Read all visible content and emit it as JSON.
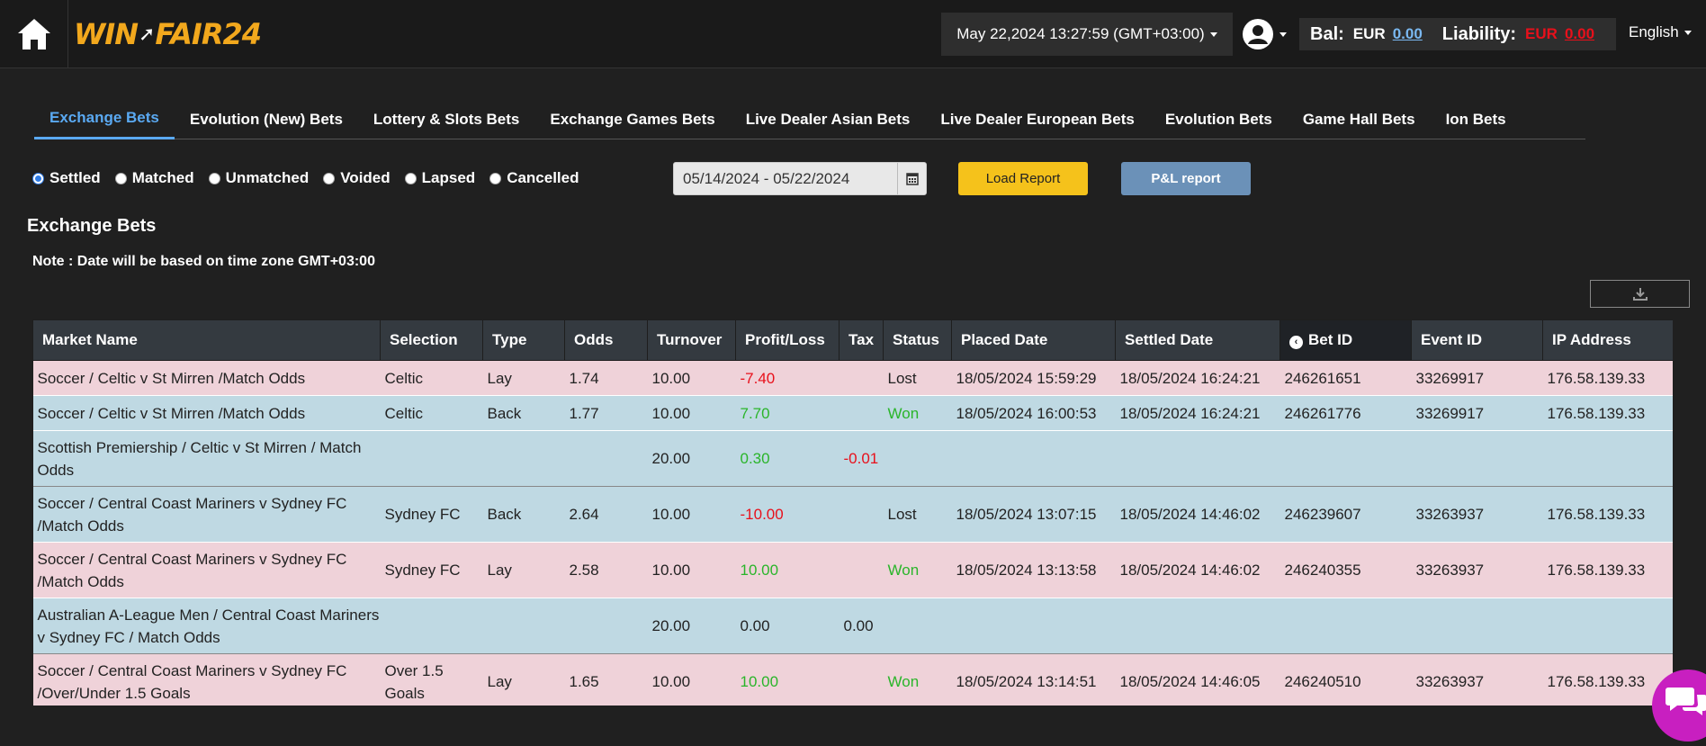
{
  "header": {
    "logo_text": "WIN",
    "logo_text2": "FAIR24",
    "datetime": "May 22,2024 13:27:59 (GMT+03:00)",
    "bal_label": "Bal:",
    "bal_currency": "EUR",
    "bal_value": "0.00",
    "liability_label": "Liability:",
    "liability_currency": "EUR",
    "liability_value": "0.00",
    "language": "English"
  },
  "tabs": [
    "Exchange Bets",
    "Evolution (New) Bets",
    "Lottery & Slots Bets",
    "Exchange Games Bets",
    "Live Dealer Asian Bets",
    "Live Dealer European Bets",
    "Evolution Bets",
    "Game Hall Bets",
    "Ion Bets"
  ],
  "filters": {
    "options": [
      "Settled",
      "Matched",
      "Unmatched",
      "Voided",
      "Lapsed",
      "Cancelled"
    ],
    "selected": "Settled",
    "date_range": "05/14/2024 - 05/22/2024",
    "load_report": "Load Report",
    "pl_report": "P&L report"
  },
  "section_title": "Exchange Bets",
  "note": "Note : Date will be based on time zone GMT+03:00",
  "table": {
    "headers": [
      "Market Name",
      "Selection",
      "Type",
      "Odds",
      "Turnover",
      "Profit/Loss",
      "Tax",
      "Status",
      "Placed Date",
      "Settled Date",
      "Bet ID",
      "Event ID",
      "IP Address"
    ],
    "rows": [
      {
        "kind": "lay",
        "market": "Soccer / Celtic v St Mirren /Match Odds",
        "selection": "Celtic",
        "type": "Lay",
        "odds": "1.74",
        "turnover": "10.00",
        "pl": "-7.40",
        "pl_sign": "neg",
        "tax": "",
        "tax_sign": "",
        "status": "Lost",
        "status_sign": "",
        "placed": "18/05/2024 15:59:29",
        "settled": "18/05/2024 16:24:21",
        "bet_id": "246261651",
        "event_id": "33269917",
        "ip": "176.58.139.33"
      },
      {
        "kind": "back",
        "market": "Soccer / Celtic v St Mirren /Match Odds",
        "selection": "Celtic",
        "type": "Back",
        "odds": "1.77",
        "turnover": "10.00",
        "pl": "7.70",
        "pl_sign": "pos",
        "tax": "",
        "tax_sign": "",
        "status": "Won",
        "status_sign": "pos",
        "placed": "18/05/2024 16:00:53",
        "settled": "18/05/2024 16:24:21",
        "bet_id": "246261776",
        "event_id": "33269917",
        "ip": "176.58.139.33"
      },
      {
        "kind": "total",
        "market": "Scottish Premiership / Celtic v St Mirren / Match Odds",
        "selection": "",
        "type": "",
        "odds": "",
        "turnover": "20.00",
        "pl": "0.30",
        "pl_sign": "pos",
        "tax": "-0.01",
        "tax_sign": "neg",
        "status": "",
        "status_sign": "",
        "placed": "",
        "settled": "",
        "bet_id": "",
        "event_id": "",
        "ip": ""
      },
      {
        "kind": "back",
        "market": "Soccer / Central Coast Mariners v Sydney FC /Match Odds",
        "selection": "Sydney FC",
        "type": "Back",
        "odds": "2.64",
        "turnover": "10.00",
        "pl": "-10.00",
        "pl_sign": "neg",
        "tax": "",
        "tax_sign": "",
        "status": "Lost",
        "status_sign": "",
        "placed": "18/05/2024 13:07:15",
        "settled": "18/05/2024 14:46:02",
        "bet_id": "246239607",
        "event_id": "33263937",
        "ip": "176.58.139.33"
      },
      {
        "kind": "lay",
        "market": "Soccer / Central Coast Mariners v Sydney FC /Match Odds",
        "selection": "Sydney FC",
        "type": "Lay",
        "odds": "2.58",
        "turnover": "10.00",
        "pl": "10.00",
        "pl_sign": "pos",
        "tax": "",
        "tax_sign": "",
        "status": "Won",
        "status_sign": "pos",
        "placed": "18/05/2024 13:13:58",
        "settled": "18/05/2024 14:46:02",
        "bet_id": "246240355",
        "event_id": "33263937",
        "ip": "176.58.139.33"
      },
      {
        "kind": "total",
        "market": "Australian A-League Men / Central Coast Mariners v Sydney FC / Match Odds",
        "selection": "",
        "type": "",
        "odds": "",
        "turnover": "20.00",
        "pl": "0.00",
        "pl_sign": "",
        "tax": "0.00",
        "tax_sign": "",
        "status": "",
        "status_sign": "",
        "placed": "",
        "settled": "",
        "bet_id": "",
        "event_id": "",
        "ip": ""
      },
      {
        "kind": "lay",
        "market": "Soccer / Central Coast Mariners v Sydney FC /Over/Under 1.5 Goals",
        "selection": "Over 1.5 Goals",
        "type": "Lay",
        "odds": "1.65",
        "turnover": "10.00",
        "pl": "10.00",
        "pl_sign": "pos",
        "tax": "",
        "tax_sign": "",
        "status": "Won",
        "status_sign": "pos",
        "placed": "18/05/2024 13:14:51",
        "settled": "18/05/2024 14:46:05",
        "bet_id": "246240510",
        "event_id": "33263937",
        "ip": "176.58.139.33"
      }
    ]
  },
  "colors": {
    "accent": "#5aa9f2",
    "load_button": "#f5c21b",
    "pl_button": "#6b91b8",
    "lay_row": "#efd2d9",
    "back_row": "#bfd9e3",
    "profit": "#2ab52a",
    "loss": "#e8101b"
  },
  "icons": [
    "home-icon",
    "user-avatar-icon",
    "calendar-icon",
    "download-icon",
    "sort-icon",
    "chat-icon"
  ]
}
